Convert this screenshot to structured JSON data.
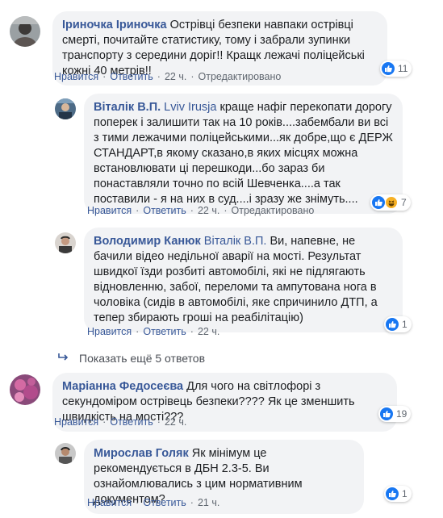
{
  "comments": [
    {
      "author": "Іриночка Іриночка",
      "text": "Острівці безпеки навпаки острівці смерті, почитайте статистику, тому і забрали зупинки транспорту з середини доріг!! Кращк лежачі поліцейські кожні 40 метрів!!",
      "like": "Нравится",
      "reply": "Ответить",
      "time": "22 ч.",
      "edited": "Отредактировано",
      "reactions": "11"
    },
    {
      "author": "Віталік В.П.",
      "mention": "Lviv Irusja",
      "text": "краще нафіг перекопати дорогу поперек і залишити так на 10 років....забембали ви всі з тими лежачими поліцейськими...як добре,що є ДЕРЖ СТАНДАРТ,в якому сказано,в яких місцях можна встановлювати ці перешкоди...бо зараз би понаставляли точно по всій Шевченка....а так поставили - я на них в суд....і зразу же знімуть....",
      "like": "Нравится",
      "reply": "Ответить",
      "time": "22 ч.",
      "edited": "Отредактировано",
      "reactions": "7"
    },
    {
      "author": "Володимир Канюк",
      "mention": "Віталік В.П.",
      "text": "Ви, напевне, не бачили відео недільної аварії на мості. Результат швидкої їзди розбиті автомобілі, які не підлягають відновленню, забої, переломи та ампутована нога в чоловіка (сидів в автомобілі, яке спричинило ДТП, а тепер збирають гроші на реабілітацію)",
      "like": "Нравится",
      "reply": "Ответить",
      "time": "22 ч.",
      "reactions": "1"
    },
    {
      "author": "Маріанна Федосеєва",
      "text": "Для чого на світлофорі з секундоміром острівець безпеки???? Як це зменшить швидкість на мості???",
      "like": "Нравится",
      "reply": "Ответить",
      "time": "22 ч.",
      "reactions": "19"
    },
    {
      "author": "Мирослав Голяк",
      "text": "Як мінімум це рекомендується в ДБН 2.3-5. Ви ознайомлювались з цим нормативним документом?",
      "like": "Нравится",
      "reply": "Ответить",
      "time": "21 ч.",
      "reactions": "1"
    }
  ],
  "more_replies": "Показать ещё 5 ответов",
  "colors": {
    "link": "#385898",
    "bubble": "#f2f3f5",
    "like": "#1877f2",
    "haha": "#f7b125"
  }
}
